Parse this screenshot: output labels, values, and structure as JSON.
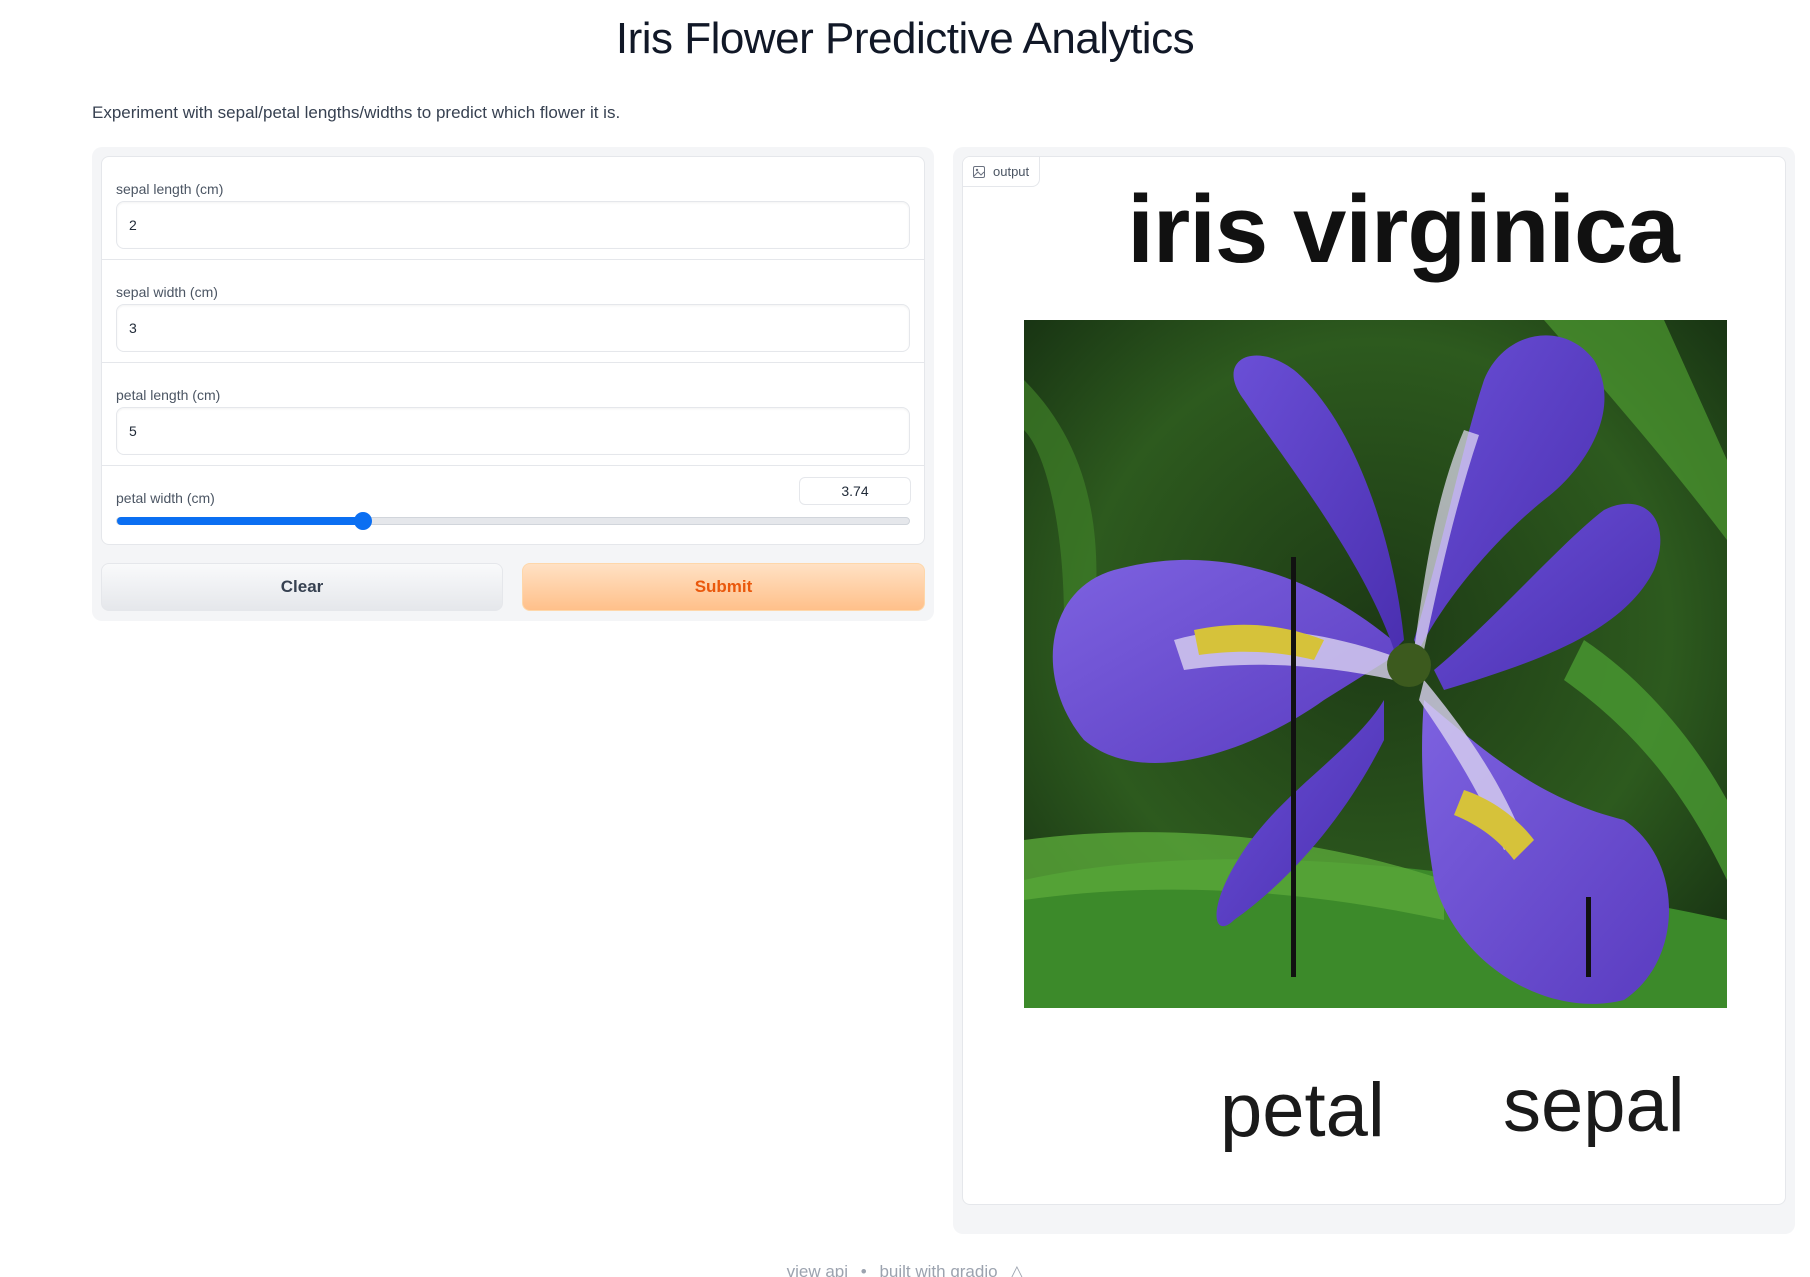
{
  "title": "Iris Flower Predictive Analytics",
  "description": "Experiment with sepal/petal lengths/widths to predict which flower it is.",
  "inputs": {
    "sepal_length": {
      "label": "sepal length (cm)",
      "value": "2"
    },
    "sepal_width": {
      "label": "sepal width (cm)",
      "value": "3"
    },
    "petal_length": {
      "label": "petal length (cm)",
      "value": "5"
    },
    "petal_width": {
      "label": "petal width (cm)",
      "value": "3.74",
      "fraction": 0.31
    }
  },
  "buttons": {
    "clear": "Clear",
    "submit": "Submit"
  },
  "output": {
    "tag": "output",
    "prediction": "iris virginica",
    "labels": {
      "petal": "petal",
      "sepal": "sepal"
    }
  },
  "footer": {
    "view_api": "view api",
    "separator": "•",
    "built_with": "built with gradio"
  },
  "colors": {
    "accent": "#0b6ff2",
    "submit_text": "#ea580c",
    "petal": "#5b3ec8"
  }
}
